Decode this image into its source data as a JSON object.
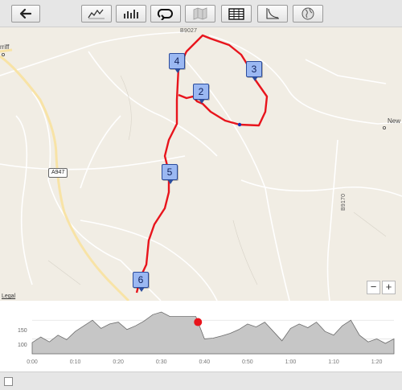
{
  "toolbar": {
    "buttons": [
      {
        "name": "back-button",
        "icon": "back-arrow-icon"
      },
      {
        "name": "chart-line-button",
        "icon": "line-chart-icon"
      },
      {
        "name": "chart-bars-button",
        "icon": "bar-chart-icon"
      },
      {
        "name": "loop-button",
        "icon": "loop-icon"
      },
      {
        "name": "map-button",
        "icon": "map-icon"
      },
      {
        "name": "table-button",
        "icon": "table-icon"
      },
      {
        "name": "curve-button",
        "icon": "curve-icon"
      },
      {
        "name": "globe-button",
        "icon": "globe-icon"
      }
    ]
  },
  "map": {
    "road_labels": [
      "B9027",
      "B9170",
      "A947"
    ],
    "place_labels": [
      "rriff",
      "New"
    ],
    "legal": "Legal",
    "markers": [
      "2",
      "3",
      "4",
      "5",
      "6"
    ],
    "zoom_out": "−",
    "zoom_in": "+",
    "route_color": "#e8141c"
  },
  "profile": {
    "y_ticks": [
      "150",
      "100"
    ],
    "x_ticks": [
      "0:00",
      "0:10",
      "0:20",
      "0:30",
      "0:40",
      "0:50",
      "1:00",
      "1:10",
      "1:20"
    ],
    "marker_color": "#e8141c"
  },
  "chart_data": {
    "type": "area",
    "title": "",
    "xlabel": "",
    "ylabel": "",
    "x_unit": "minutes",
    "xlim": [
      0,
      84
    ],
    "ylim": [
      60,
      185
    ],
    "x": [
      0,
      2,
      4,
      6,
      8,
      10,
      12,
      14,
      16,
      18,
      20,
      22,
      24,
      26,
      28,
      30,
      32,
      34,
      36,
      38,
      40,
      42,
      44,
      46,
      48,
      50,
      52,
      54,
      56,
      58,
      60,
      62,
      64,
      66,
      68,
      70,
      72,
      74,
      76,
      78,
      80,
      82,
      84
    ],
    "values": [
      90,
      105,
      92,
      110,
      98,
      120,
      135,
      150,
      128,
      140,
      145,
      125,
      135,
      148,
      165,
      172,
      160,
      160,
      160,
      160,
      100,
      102,
      108,
      115,
      125,
      140,
      132,
      145,
      120,
      95,
      128,
      140,
      130,
      145,
      120,
      110,
      135,
      150,
      110,
      92,
      100,
      88,
      100
    ],
    "current_x": 38.5,
    "grid": true
  }
}
